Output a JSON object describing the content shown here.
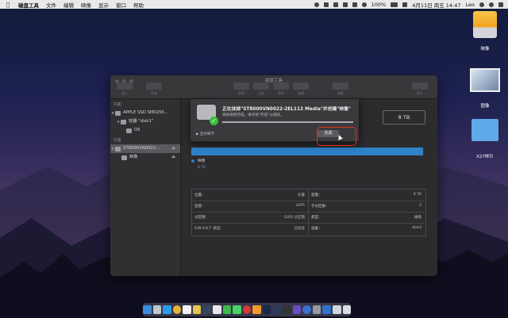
{
  "menubar": {
    "apple": "",
    "items": [
      "磁盘工具",
      "文件",
      "编辑",
      "映像",
      "显示",
      "窗口",
      "帮助"
    ],
    "battery": "100%",
    "date_time": "4月11日 周五 14:47",
    "user": "Leo"
  },
  "desktop_icons": [
    {
      "label": "映像",
      "icon": "drive-icon"
    },
    {
      "label": "图像",
      "icon": "image-icon"
    },
    {
      "label": "X27样片",
      "icon": "folder-icon"
    }
  ],
  "window": {
    "title": "磁盘工具",
    "toolbar_labels": [
      "显示",
      "宗卷",
      "急救",
      "分区",
      "抹掉",
      "恢复",
      "装载",
      "简介"
    ],
    "sidebar": {
      "internal_header": "内置",
      "internal_disk": "APPLE SSD SM0256...",
      "container": "容器 \"disk1\"",
      "os_volume": "OS",
      "external_header": "外置",
      "external_disk": "ST8000VN0022-...",
      "external_volume": "映像"
    },
    "capacity": "8 TB",
    "volume_name": "映像",
    "volume_size": "8 TB",
    "info_left": [
      {
        "k": "位置：",
        "v": "外置"
      },
      {
        "k": "连接：",
        "v": "SATA"
      },
      {
        "k": "分区图：",
        "v": "GUID 分区图"
      },
      {
        "k": "S.M.A.R.T. 状态：",
        "v": "已验证"
      }
    ],
    "info_right": [
      {
        "k": "容量：",
        "v": "8 TB"
      },
      {
        "k": "子分区数：",
        "v": "2"
      },
      {
        "k": "类型：",
        "v": "磁盘"
      },
      {
        "k": "设备：",
        "v": "disk3"
      }
    ]
  },
  "sheet": {
    "title": "正在抹掉\"ST8000VN0022-2EL112 Media\"并创建\"映像\"",
    "subtitle": "抹掉进程完成。请点按\"完成\"以继续。",
    "progress": 1.0,
    "detail": "显示细节",
    "done_label": "完成"
  },
  "colors": {
    "accent_blue": "#2f82c8",
    "highlight_red": "#e0301e",
    "success_green": "#3cbf3c"
  }
}
